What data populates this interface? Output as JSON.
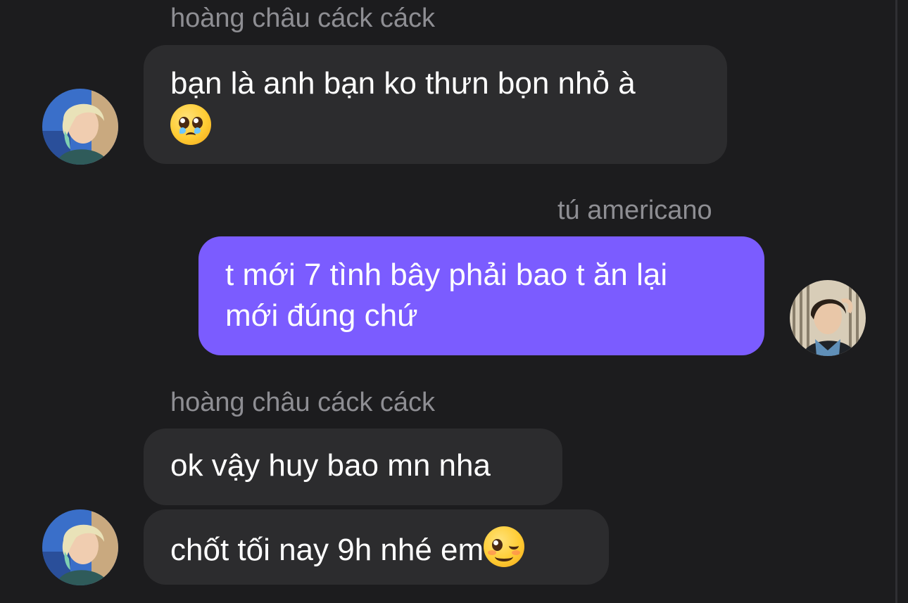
{
  "messages": [
    {
      "sender": "hoàng châu cáck cáck",
      "lines": [
        "bạn là anh bạn ko thưn bọn nhỏ à",
        ""
      ],
      "emoji": "pleading-face-emoji"
    },
    {
      "sender": "tú americano",
      "lines": [
        "t mới 7 tình bây phải bao t ăn lại",
        "mới đúng chứ"
      ]
    },
    {
      "sender": "hoàng châu cáck cáck",
      "lines": [
        "ok vậy huy bao mn nha"
      ]
    },
    {
      "lines": [
        "chốt tối nay 9h nhé em"
      ],
      "emoji": "winking-face-emoji"
    }
  ],
  "avatars": {
    "incoming": "avatar-hoang-chau",
    "outgoing": "avatar-tu-americano"
  },
  "colors": {
    "background": "#1c1c1e",
    "incoming_bubble": "#2c2c2e",
    "outgoing_bubble": "#7b5cff",
    "sender_name": "#8e8e93",
    "message_text": "#ffffff"
  }
}
